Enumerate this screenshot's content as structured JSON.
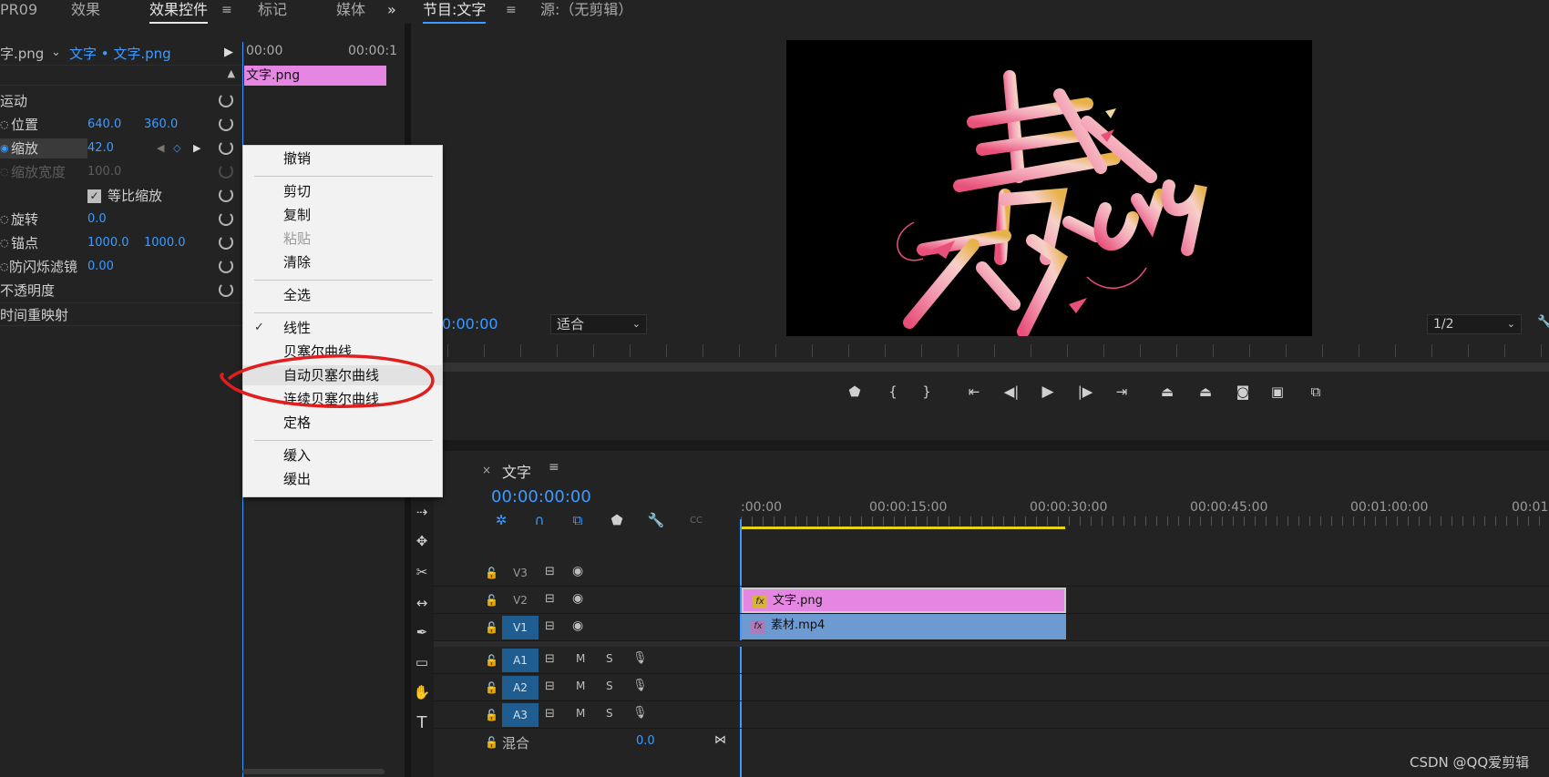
{
  "left_tabs": {
    "project": "PR09",
    "effects": "效果",
    "effect_controls": "效果控件",
    "markers": "标记",
    "media": "媒体",
    "more": "»"
  },
  "monitor_tabs": {
    "program": "节目:文字",
    "source": "源:（无剪辑）"
  },
  "effect_controls": {
    "source_clip": "字.png",
    "target_clip": "文字 • 文字.png",
    "time_start": "00:00",
    "time_end": "00:00:1",
    "clip_name": "文字.png",
    "motion": "运动",
    "properties": [
      {
        "label": "位置",
        "v1": "640.0",
        "v2": "360.0"
      },
      {
        "label": "缩放",
        "v1": "42.0",
        "v2": ""
      },
      {
        "label": "缩放宽度",
        "v1": "100.0",
        "v2": ""
      },
      {
        "label": "等比缩放",
        "v1": "",
        "v2": ""
      },
      {
        "label": "旋转",
        "v1": "0.0",
        "v2": ""
      },
      {
        "label": "锚点",
        "v1": "1000.0",
        "v2": "1000.0"
      },
      {
        "label": "防闪烁滤镜",
        "v1": "0.00",
        "v2": ""
      },
      {
        "label": "不透明度",
        "v1": "",
        "v2": ""
      },
      {
        "label": "时间重映射",
        "v1": "",
        "v2": ""
      }
    ]
  },
  "context_menu": {
    "undo": "撤销",
    "cut": "剪切",
    "copy": "复制",
    "paste": "粘贴",
    "clear": "清除",
    "select_all": "全选",
    "linear": "线性",
    "bezier": "贝塞尔曲线",
    "auto_bezier": "自动贝塞尔曲线",
    "continuous_bezier": "连续贝塞尔曲线",
    "hold": "定格",
    "ease_in": "缓入",
    "ease_out": "缓出",
    "checkmark": "✓"
  },
  "monitor": {
    "timecode": "00:00:00:00",
    "fit": "适合",
    "resolution": "1/2",
    "artwork_text": "青春不一young"
  },
  "timeline": {
    "sequence": "文字",
    "timecode": "00:00:00:00",
    "ruler": [
      ":00:00",
      "00:00:15:00",
      "00:00:30:00",
      "00:00:45:00",
      "00:01:00:00",
      "00:01:"
    ],
    "tracks": [
      "V3",
      "V2",
      "V1",
      "A1",
      "A2",
      "A3"
    ],
    "track_btn_m": "M",
    "track_btn_s": "S",
    "mix_label": "混合",
    "mix_value": "0.0",
    "clips": {
      "text": "文字.png",
      "video": "素材.mp4",
      "fx": "fx"
    }
  },
  "watermark": "CSDN @QQ爱剪辑",
  "colors": {
    "accent": "#3d9bff",
    "clip_pink": "#e586e2",
    "clip_blue": "#6d9ad0",
    "annotation": "#e01e1e"
  }
}
